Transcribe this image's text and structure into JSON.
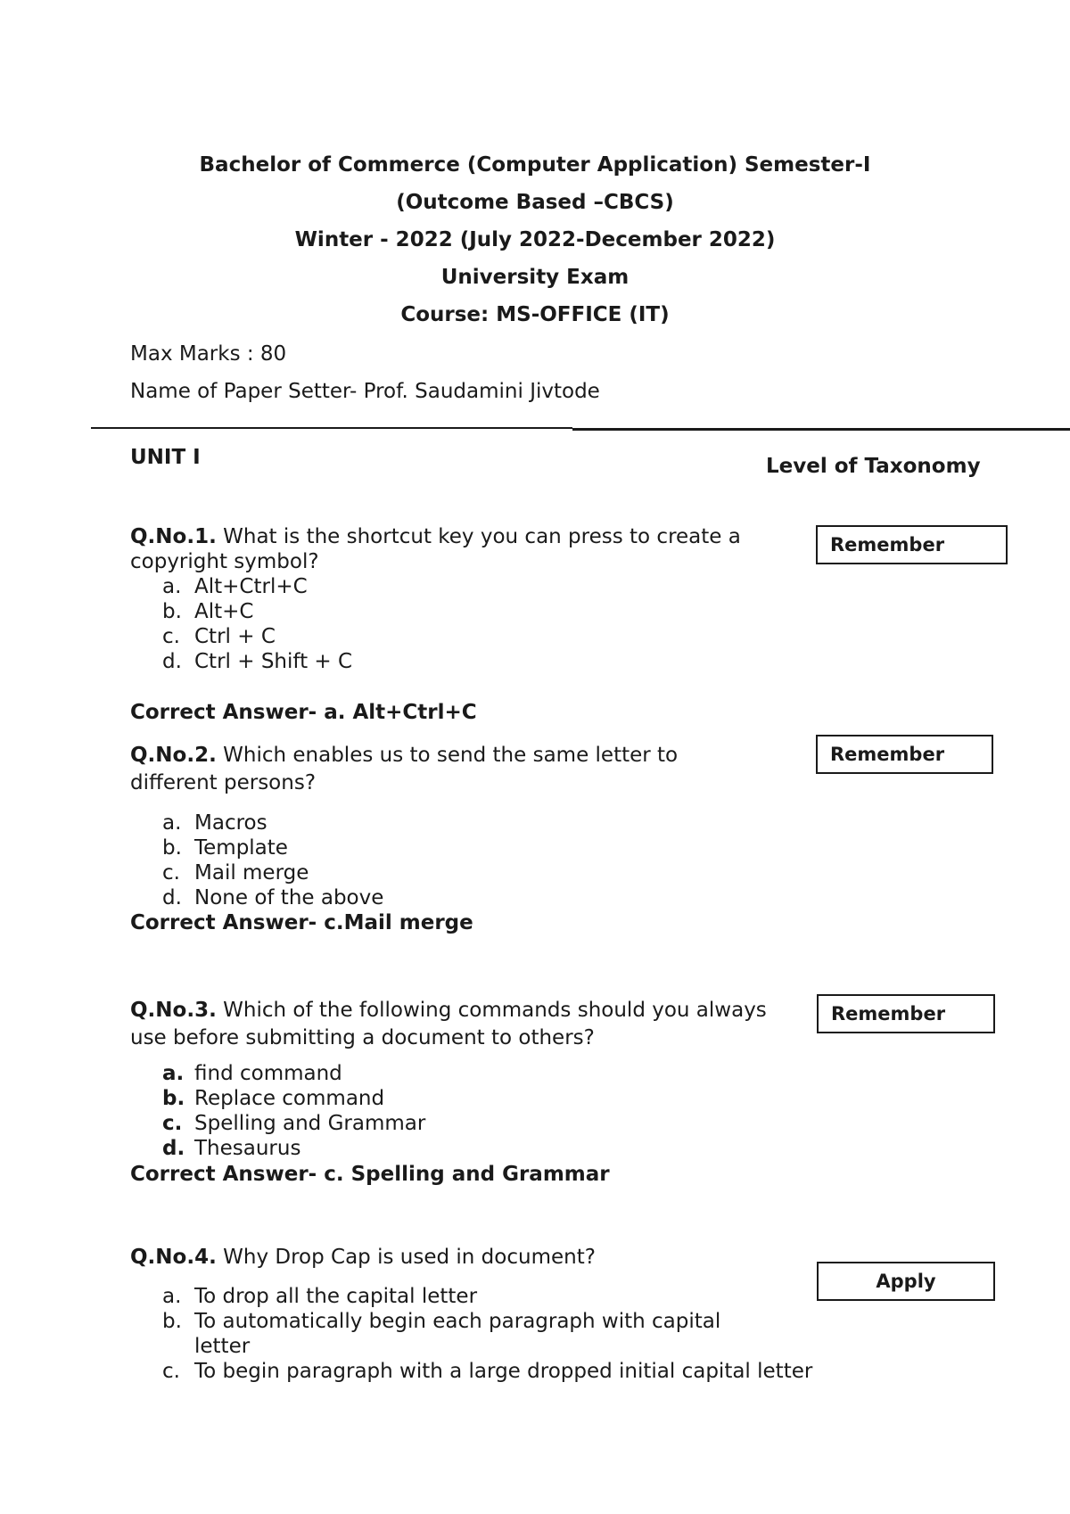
{
  "header": {
    "line1": "Bachelor of Commerce (Computer Application) Semester-I",
    "line2": "(Outcome Based –CBCS)",
    "line3": "Winter - 2022 (July 2022-December 2022)",
    "line4": "University Exam",
    "line5": "Course:  MS-OFFICE (IT)"
  },
  "meta": {
    "max_marks": "Max Marks : 80",
    "paper_setter": "Name of Paper Setter- Prof. Saudamini Jivtode"
  },
  "unit": {
    "title": "UNIT I",
    "taxonomy_header": "Level of Taxonomy"
  },
  "questions": [
    {
      "number": "Q.No.1.",
      "text_line1": " What is the shortcut key you can press to create a",
      "text_line2": "copyright symbol?",
      "taxonomy": "Remember",
      "options": [
        {
          "label": "a.",
          "text": "Alt+Ctrl+C"
        },
        {
          "label": "b.",
          "text": "Alt+C"
        },
        {
          "label": "c.",
          "text": "Ctrl + C"
        },
        {
          "label": "d.",
          "text": "Ctrl + Shift + C"
        }
      ],
      "answer": "Correct Answer- a. Alt+Ctrl+C"
    },
    {
      "number": "Q.No.2.",
      "text_line1": " Which enables us to send the same letter to",
      "text_line2": "different persons?",
      "taxonomy": "Remember",
      "options": [
        {
          "label": "a.",
          "text": "Macros"
        },
        {
          "label": "b.",
          "text": "Template"
        },
        {
          "label": "c.",
          "text": "Mail merge"
        },
        {
          "label": "d.",
          "text": "None of the above"
        }
      ],
      "answer": "Correct Answer- c.Mail merge"
    },
    {
      "number": "Q.No.3.",
      "text_line1": " Which of the following commands should you always",
      "text_line2": "use before submitting a document to others?",
      "taxonomy": "Remember",
      "options": [
        {
          "label": "a.",
          "text": "find command"
        },
        {
          "label": "b.",
          "text": "Replace command"
        },
        {
          "label": "c.",
          "text": "Spelling and Grammar"
        },
        {
          "label": "d.",
          "text": "Thesaurus"
        }
      ],
      "answer": "Correct Answer- c. Spelling and Grammar"
    },
    {
      "number": "Q.No.4.",
      "text_line1": " Why Drop Cap is used in document?",
      "taxonomy": "Apply",
      "options": [
        {
          "label": "a.",
          "text": "To drop all the capital letter"
        },
        {
          "label": "b.",
          "text": "To automatically begin each paragraph with capital"
        },
        {
          "label": "",
          "text": "letter"
        },
        {
          "label": "c.",
          "text": "To begin paragraph with a large dropped initial capital letter"
        }
      ]
    }
  ]
}
